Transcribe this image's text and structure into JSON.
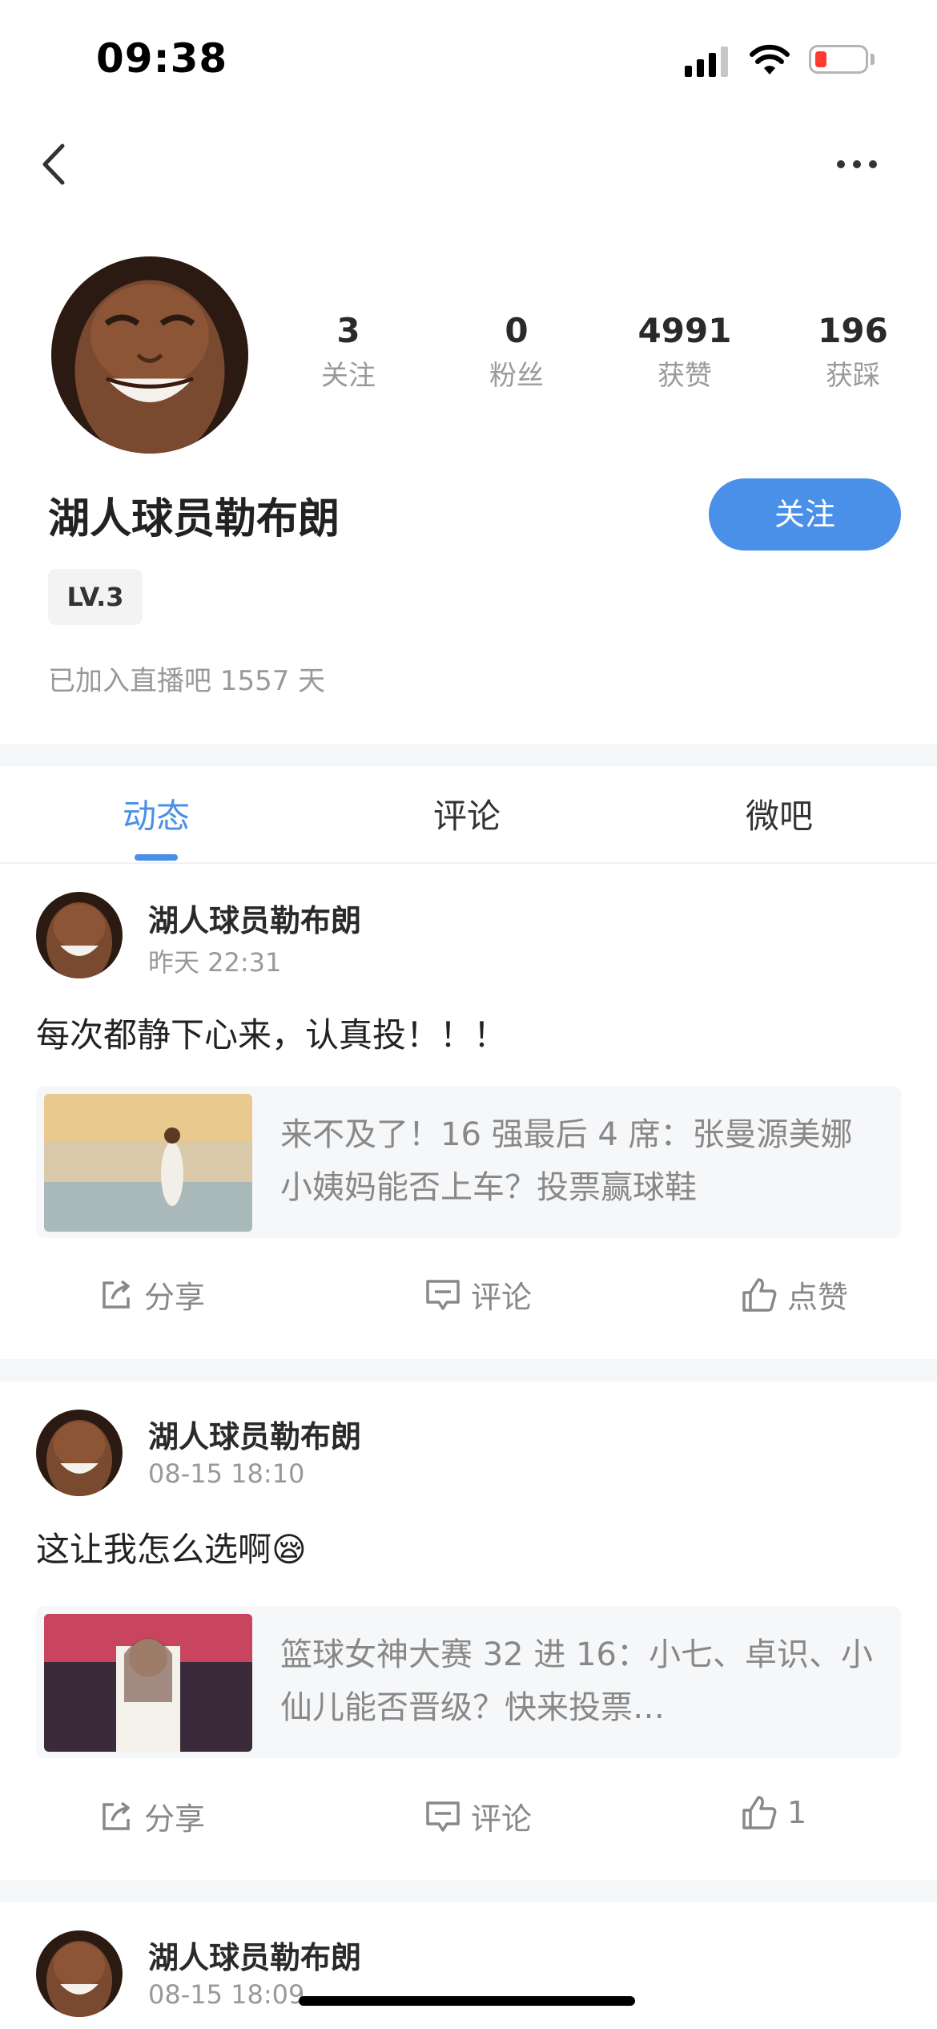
{
  "status_bar": {
    "time": "09:38",
    "battery_color": "#ff3b30"
  },
  "nav": {
    "back_icon": "chevron-left-icon",
    "more_icon": "more-dots-icon"
  },
  "profile": {
    "name": "湖人球员勒布朗",
    "stats": [
      {
        "value": "3",
        "label": "关注"
      },
      {
        "value": "0",
        "label": "粉丝"
      },
      {
        "value": "4991",
        "label": "获赞"
      },
      {
        "value": "196",
        "label": "获踩"
      }
    ],
    "follow_label": "关注",
    "level": "LV.3",
    "joined": "已加入直播吧 1557 天"
  },
  "tabs": [
    {
      "label": "动态",
      "active": true
    },
    {
      "label": "评论",
      "active": false
    },
    {
      "label": "微吧",
      "active": false
    }
  ],
  "posts": [
    {
      "author": "湖人球员勒布朗",
      "time": "昨天 22:31",
      "text": "每次都静下心来，认真投！！！",
      "card_text": "来不及了！16 强最后 4 席：张曼源美娜小姨妈能否上车？投票赢球鞋",
      "share": "分享",
      "comment": "评论",
      "like": "点赞"
    },
    {
      "author": "湖人球员勒布朗",
      "time": "08-15 18:10",
      "text": "这让我怎么选啊😪",
      "card_text": "篮球女神大赛 32 进 16：小七、卓识、小仙儿能否晋级？快来投票…",
      "share": "分享",
      "comment": "评论",
      "like": "1"
    },
    {
      "author": "湖人球员勒布朗",
      "time": "08-15 18:09"
    }
  ],
  "colors": {
    "accent": "#4a90e8",
    "muted_text": "#999999",
    "card_bg": "#f6f7f9"
  }
}
